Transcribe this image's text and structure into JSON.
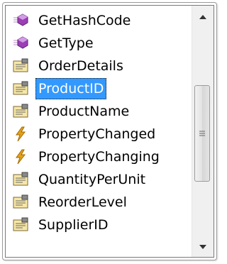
{
  "list": {
    "items": [
      {
        "label": "GetHashCode",
        "icon": "method-icon"
      },
      {
        "label": "GetType",
        "icon": "method-icon"
      },
      {
        "label": "OrderDetails",
        "icon": "property-icon"
      },
      {
        "label": "ProductID",
        "icon": "property-icon"
      },
      {
        "label": "ProductName",
        "icon": "property-icon"
      },
      {
        "label": "PropertyChanged",
        "icon": "event-icon"
      },
      {
        "label": "PropertyChanging",
        "icon": "event-icon"
      },
      {
        "label": "QuantityPerUnit",
        "icon": "property-icon"
      },
      {
        "label": "ReorderLevel",
        "icon": "property-icon"
      },
      {
        "label": "SupplierID",
        "icon": "property-icon"
      }
    ],
    "selected_item": "ProductID"
  },
  "colors": {
    "selection_background": "#3399ff",
    "selection_text": "#ffffff",
    "method_icon": "#9b3fb5",
    "event_icon": "#e3a21a",
    "property_icon_card": "#f7e7a6"
  }
}
